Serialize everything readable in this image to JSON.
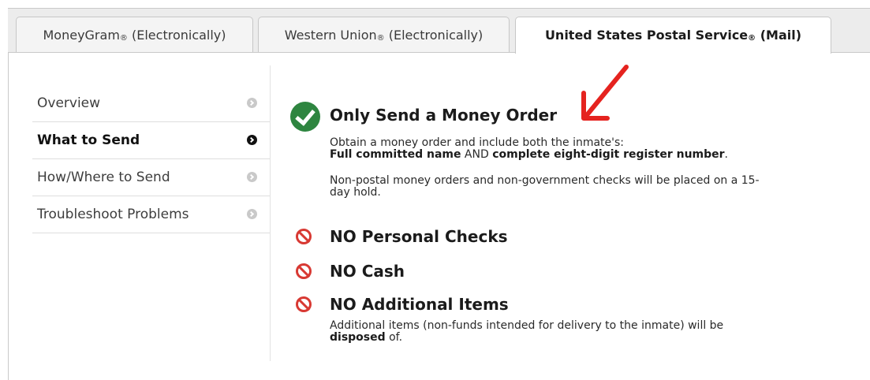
{
  "tabs": [
    {
      "label": "MoneyGram",
      "suffix": "(Electronically)"
    },
    {
      "label": "Western Union",
      "suffix": "(Electronically)"
    },
    {
      "label": "United States Postal Service",
      "suffix": "(Mail)"
    }
  ],
  "registered_mark": "®",
  "sidebar": {
    "items": [
      {
        "label": "Overview"
      },
      {
        "label": "What to Send"
      },
      {
        "label": "How/Where to Send"
      },
      {
        "label": "Troubleshoot Problems"
      }
    ]
  },
  "content": {
    "money_order": {
      "heading": "Only Send a Money Order",
      "line1": "Obtain a money order and include both the inmate's:",
      "name_bold": "Full committed name",
      "and_text": " AND ",
      "register_bold": "complete eight-digit register number",
      "period": ".",
      "hold_line1": "Non-postal money orders and non-government checks will be placed on a 15-",
      "hold_line2": "day hold."
    },
    "no_personal_checks": "NO Personal Checks",
    "no_cash": "NO Cash",
    "no_additional_items": {
      "heading": "NO Additional Items",
      "line1": "Additional items (non-funds intended for delivery to the inmate) will be",
      "disposed_bold": "disposed",
      "end": " of."
    }
  },
  "colors": {
    "check_green": "#2e8540",
    "no_red": "#d83933",
    "annotation_arrow": "#e5231f"
  }
}
